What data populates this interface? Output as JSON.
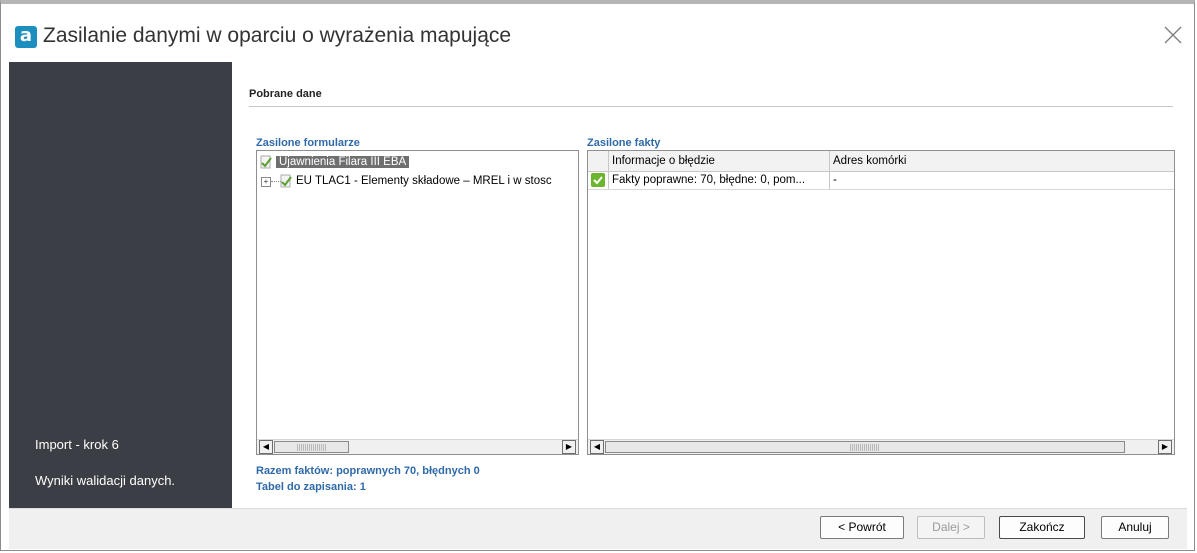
{
  "window": {
    "title": "Zasilanie danymi w oparciu o wyrażenia mapujące",
    "app_icon_letter": "a"
  },
  "sidebar": {
    "step": "Import - krok 6",
    "description": "Wyniki walidacji danych."
  },
  "content": {
    "section_title": "Pobrane dane",
    "forms_panel": {
      "label": "Zasilone formularze",
      "items": [
        {
          "label": "Ujawnienia Filara III EBA",
          "selected": true
        },
        {
          "label": "EU TLAC1 - Elementy składowe – MREL i w stosc",
          "expander": "+"
        }
      ]
    },
    "facts_panel": {
      "label": "Zasilone fakty",
      "columns": [
        "Informacje o błędzie",
        "Adres komórki"
      ],
      "rows": [
        {
          "info": "Fakty poprawne: 70, błędne: 0, pom...",
          "address": "-"
        }
      ]
    },
    "summary": {
      "facts": "Razem faktów: poprawnych 70, błędnych 0",
      "tables": "Tabel do zapisania: 1"
    }
  },
  "footer": {
    "back": "< Powrót",
    "next": "Dalej >",
    "finish": "Zakończ",
    "cancel": "Anuluj"
  },
  "colors": {
    "sidebar": "#3b3e44",
    "accent_blue": "#2f6aa8",
    "check_green": "#6cb52d",
    "app_icon": "#1d8fbf"
  },
  "icons": {
    "close": "close-icon",
    "form": "form-check-icon",
    "status": "check-icon"
  }
}
